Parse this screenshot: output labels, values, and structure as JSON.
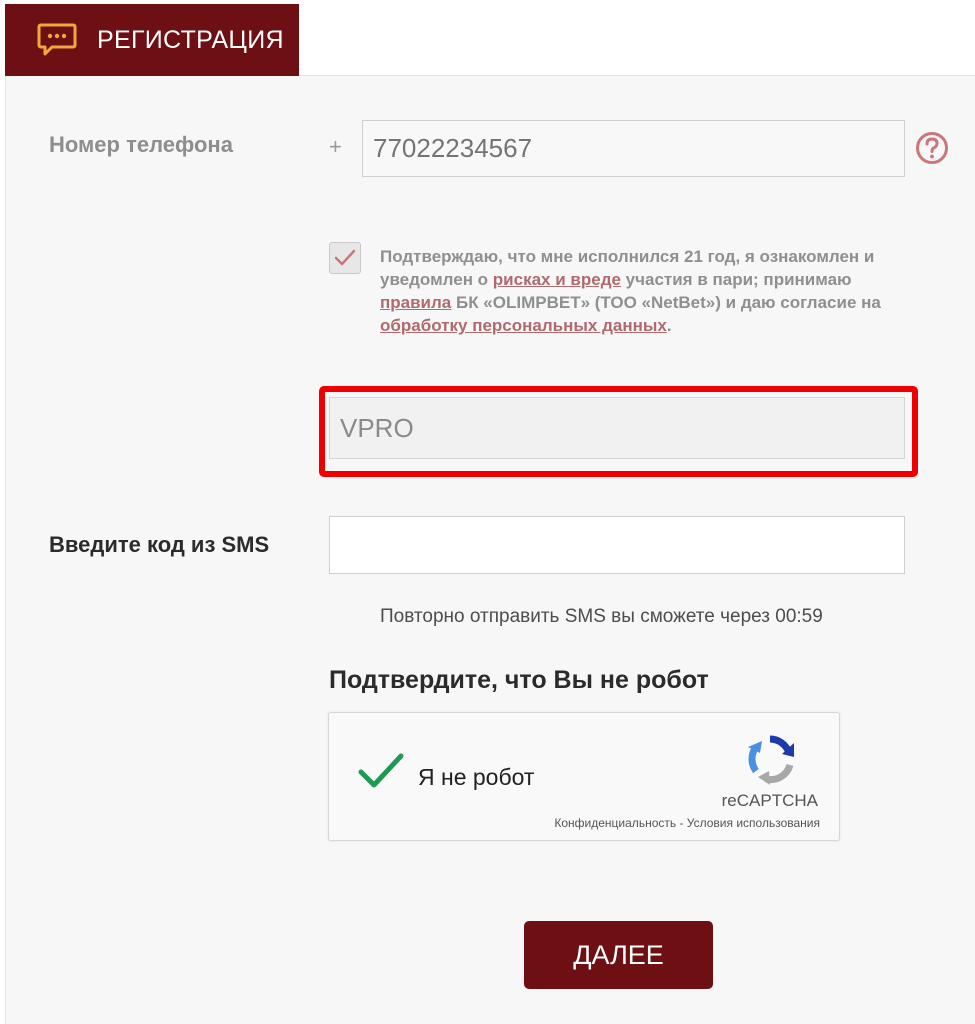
{
  "tab": {
    "label": "РЕГИСТРАЦИЯ",
    "icon": "chat-icon"
  },
  "phone": {
    "label": "Номер телефона",
    "prefix": "+",
    "value": "77022234567",
    "help_icon": "question-icon"
  },
  "agreement": {
    "checked": true,
    "t1": "Подтверждаю, что мне исполнился 21 год, я ознакомлен и уведомлен о ",
    "link_risks": "рисках и вреде",
    "t2": " участия в пари; принимаю ",
    "link_rules": "правила",
    "t3": " БК «OLIMPBET» (ТОО «NetBet») и даю согласие на ",
    "link_data": "обработку персональных данных",
    "t4": "."
  },
  "promo": {
    "value": "VPRO"
  },
  "sms": {
    "label": "Введите код из SMS",
    "value": "",
    "resend_text": "Повторно отправить SMS вы сможете через 00:59"
  },
  "captcha": {
    "heading": "Подтвердите, что Вы не робот",
    "label": "Я не робот",
    "brand": "reCAPTCHA",
    "privacy": "Конфиденциальность",
    "separator": " - ",
    "terms": "Условия использования"
  },
  "next_button": "ДАЛЕЕ",
  "colors": {
    "brand": "#6e0f14",
    "highlight": "#ee0000",
    "link": "#b06a6e",
    "check": "#1e9a52"
  }
}
